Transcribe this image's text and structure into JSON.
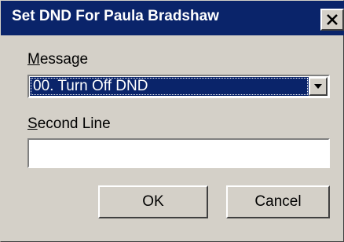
{
  "window": {
    "title": "Set DND For Paula Bradshaw",
    "close_icon": "close-icon"
  },
  "message": {
    "label": "Message",
    "selected_value": "00.  Turn Off DND",
    "dropdown_icon": "chevron-down-icon"
  },
  "second_line": {
    "label": "Second Line",
    "value": ""
  },
  "buttons": {
    "ok_label": "OK",
    "cancel_label": "Cancel"
  },
  "colors": {
    "titlebar": "#0a246a",
    "face": "#d4d0c8",
    "selection": "#0a246a"
  }
}
